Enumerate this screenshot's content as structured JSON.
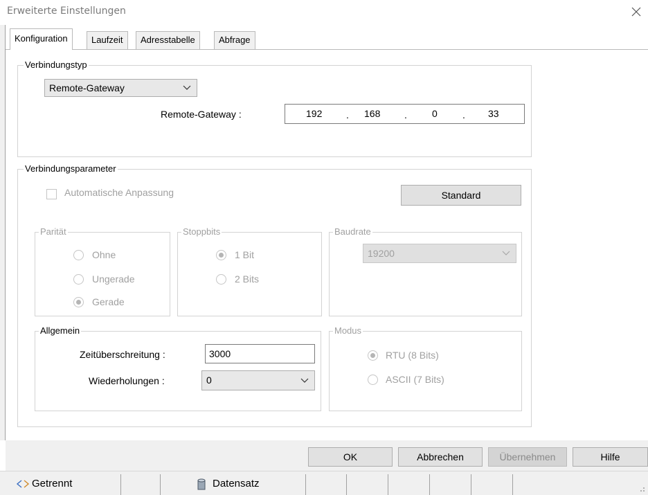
{
  "window": {
    "title": "Erweiterte Einstellungen"
  },
  "tabs": [
    {
      "label": "Konfiguration"
    },
    {
      "label": "Laufzeit"
    },
    {
      "label": "Adresstabelle"
    },
    {
      "label": "Abfrage"
    }
  ],
  "verbindungstyp": {
    "title": "Verbindungstyp",
    "selected": "Remote-Gateway",
    "gateway_label": "Remote-Gateway :",
    "ip": [
      "192",
      "168",
      "0",
      "33"
    ],
    "ip_sep": "."
  },
  "verbindungsparameter": {
    "title": "Verbindungsparameter",
    "auto_label": "Automatische Anpassung",
    "standard_button": "Standard",
    "paritaet": {
      "title": "Parität",
      "options": [
        "Ohne",
        "Ungerade",
        "Gerade"
      ],
      "selected": "Gerade"
    },
    "stoppbits": {
      "title": "Stoppbits",
      "options": [
        "1 Bit",
        "2 Bits"
      ],
      "selected": "1 Bit"
    },
    "baudrate": {
      "title": "Baudrate",
      "selected": "19200"
    },
    "allgemein": {
      "title": "Allgemein",
      "timeout_label": "Zeitüberschreitung :",
      "timeout_value": "3000",
      "retries_label": "Wiederholungen :",
      "retries_value": "0"
    },
    "modus": {
      "title": "Modus",
      "options": [
        "RTU (8 Bits)",
        "ASCII (7 Bits)"
      ],
      "selected": "RTU (8 Bits)"
    }
  },
  "buttons": {
    "ok": "OK",
    "cancel": "Abbrechen",
    "apply": "Übernehmen",
    "help": "Hilfe"
  },
  "statusbar": {
    "connection": "Getrennt",
    "dataset": "Datensatz"
  }
}
